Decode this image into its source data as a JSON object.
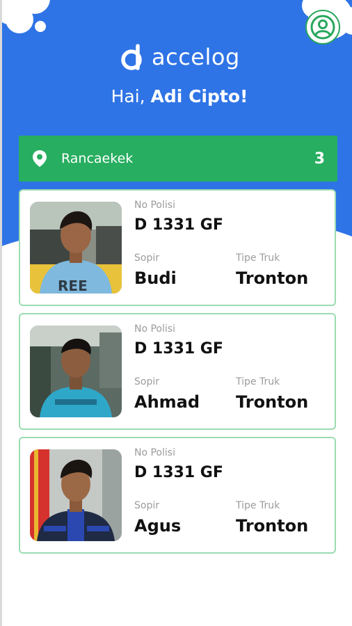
{
  "app": {
    "logo_text": "accelog",
    "greeting_prefix": "Hai, ",
    "greeting_name": "Adi Cipto!",
    "colors": {
      "primary_blue": "#2f74e6",
      "accent_green": "#27ae60",
      "card_border": "#9bdcb1"
    },
    "profile_icon": "user-circle-icon"
  },
  "location": {
    "icon": "map-pin-icon",
    "name": "Rancaekek",
    "count": "3"
  },
  "cards": [
    {
      "plate_label": "No Polisi",
      "plate": "D 1331 GF",
      "driver_label": "Sopir",
      "driver": "Budi",
      "type_label": "Tipe Truk",
      "type": "Tronton",
      "shirt_text": "REE"
    },
    {
      "plate_label": "No Polisi",
      "plate": "D 1331 GF",
      "driver_label": "Sopir",
      "driver": "Ahmad",
      "type_label": "Tipe Truk",
      "type": "Tronton"
    },
    {
      "plate_label": "No Polisi",
      "plate": "D 1331 GF",
      "driver_label": "Sopir",
      "driver": "Agus",
      "type_label": "Tipe Truk",
      "type": "Tronton"
    }
  ]
}
